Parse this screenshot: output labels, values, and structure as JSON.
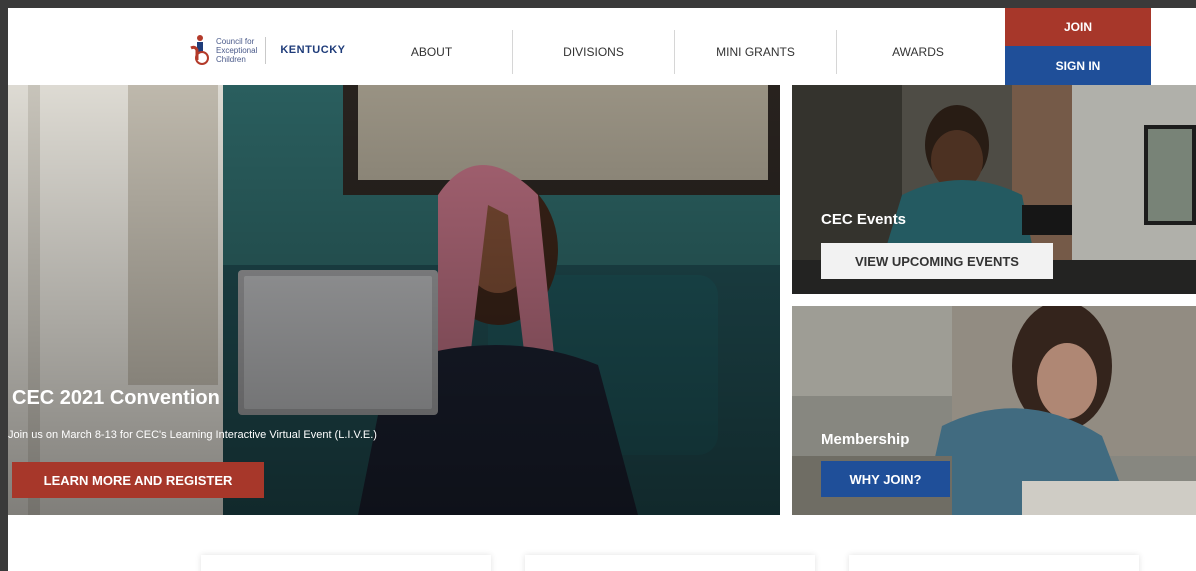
{
  "header": {
    "logo": {
      "line1": "Council for",
      "line2": "Exceptional",
      "line3": "Children",
      "state": "KENTUCKY"
    },
    "nav": [
      {
        "label": "ABOUT"
      },
      {
        "label": "DIVISIONS"
      },
      {
        "label": "MINI GRANTS"
      },
      {
        "label": "AWARDS"
      }
    ],
    "join_label": "JOIN",
    "signin_label": "SIGN IN"
  },
  "hero": {
    "title": "CEC 2021 Convention",
    "subtitle": "Join us on March 8-13 for CEC's Learning Interactive Virtual Event (L.I.V.E.)",
    "button_label": "LEARN MORE AND REGISTER"
  },
  "cards": {
    "events": {
      "title": "CEC Events",
      "button_label": "VIEW UPCOMING EVENTS"
    },
    "membership": {
      "title": "Membership",
      "button_label": "WHY JOIN?"
    }
  },
  "colors": {
    "join": "#a7372a",
    "signin": "#1f4f99",
    "brand_text": "#1f3c7a"
  }
}
